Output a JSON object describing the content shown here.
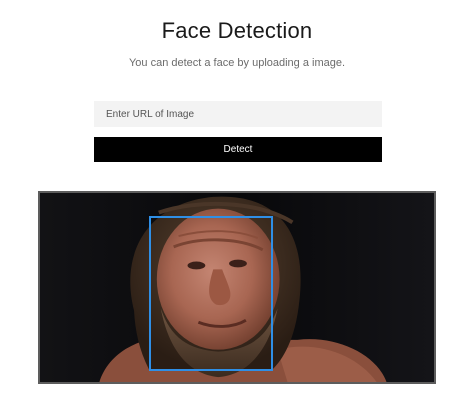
{
  "header": {
    "title": "Face Detection",
    "subtitle": "You can detect a face by uploading a image."
  },
  "form": {
    "url_placeholder": "Enter URL of Image",
    "url_value": "",
    "detect_label": "Detect"
  },
  "result": {
    "face_count": 1,
    "box_color": "#2f8fe6"
  }
}
